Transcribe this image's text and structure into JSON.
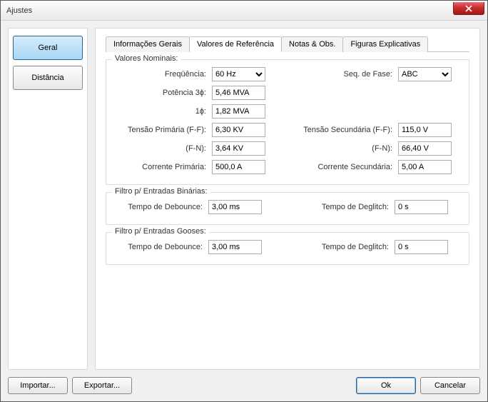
{
  "window": {
    "title": "Ajustes"
  },
  "sidebar": {
    "geral": "Geral",
    "distancia": "Distância"
  },
  "tabs": {
    "info": "Informações Gerais",
    "ref": "Valores de Referência",
    "notas": "Notas & Obs.",
    "figuras": "Figuras Explicativas"
  },
  "nominal": {
    "title": "Valores Nominais:",
    "freq_label": "Freqüência:",
    "freq_value": "60 Hz",
    "seq_label": "Seq. de Fase:",
    "seq_value": "ABC",
    "pot3_label": "Potência 3ɸ:",
    "pot3_value": "5,46 MVA",
    "pot1_label": "1ɸ:",
    "pot1_value": "1,82 MVA",
    "vp_ff_label": "Tensão Primária (F-F):",
    "vp_ff_value": "6,30 KV",
    "vs_ff_label": "Tensão Secundária (F-F):",
    "vs_ff_value": "115,0 V",
    "vp_fn_label": "(F-N):",
    "vp_fn_value": "3,64 KV",
    "vs_fn_label": "(F-N):",
    "vs_fn_value": "66,40 V",
    "ip_label": "Corrente Primária:",
    "ip_value": "500,0 A",
    "is_label": "Corrente Secundária:",
    "is_value": "5,00 A"
  },
  "filter_bin": {
    "title": "Filtro p/ Entradas Binárias:",
    "debounce_label": "Tempo de Debounce:",
    "debounce_value": "3,00 ms",
    "deglitch_label": "Tempo de Deglitch:",
    "deglitch_value": "0 s"
  },
  "filter_goose": {
    "title": "Filtro p/ Entradas Gooses:",
    "debounce_label": "Tempo de Debounce:",
    "debounce_value": "3,00 ms",
    "deglitch_label": "Tempo de Deglitch:",
    "deglitch_value": "0 s"
  },
  "footer": {
    "importar": "Importar...",
    "exportar": "Exportar...",
    "ok": "Ok",
    "cancelar": "Cancelar"
  }
}
